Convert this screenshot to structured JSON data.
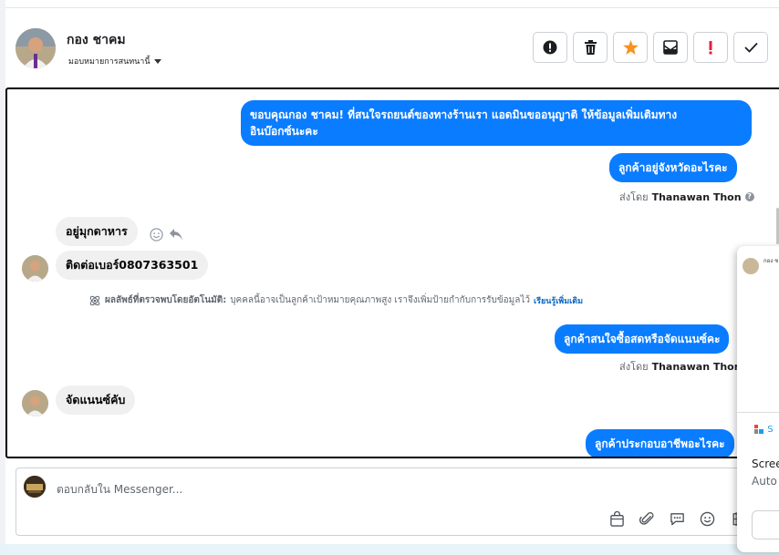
{
  "header": {
    "contact_name": "กอง ชาคม",
    "assign_label": "มอบหมายการสนทนานี้"
  },
  "toolbar": {
    "buttons": [
      {
        "icon": "exclamation-circle-icon"
      },
      {
        "icon": "trash-icon"
      },
      {
        "icon": "star-icon",
        "color": "#f7931e"
      },
      {
        "icon": "archive-mail-icon"
      },
      {
        "icon": "spam-icon",
        "color": "#e41e3f"
      },
      {
        "icon": "check-icon"
      }
    ]
  },
  "messages": {
    "out1_line1": "ขอบคุณกอง ชาคม! ที่สนใจรถยนต์ของทางร้านเรา แอดมินขออนุญาติ ให้ข้อมูลเพิ่มเติมทาง",
    "out1_line2": "อินบ๊อกซ์นะคะ",
    "out2": "ลูกค้าอยู่จังหวัดอะไรคะ",
    "sent_by_label_1": "ส่งโดย",
    "sent_by_name_1": "Thanawan Thon",
    "in1": "อยู่มุกดาหาร",
    "in2": "ติดต่อเบอร์0807363501",
    "auto_bold": "ผลลัพธ์ที่ตรวจพบโดยอัตโนมัติ:",
    "auto_text": "บุคคลนี้อาจเป็นลูกค้าเป้าหมายคุณภาพสูง เราจึงเพิ่มป้ายกำกับการรับข้อมูลไว้",
    "auto_link": "เรียนรู้เพิ่มเติม",
    "out3": "ลูกค้าสนใจซื้อสดหรือจัดแนนซ์คะ",
    "sent_by_label_2": "ส่งโดย",
    "sent_by_name_2": "Thanawan Thon",
    "in3": "จัดแนนซ์คับ",
    "out4": "ลูกค้าประกอบอาชีพอะไรคะ"
  },
  "composer": {
    "placeholder": "ตอบกลับใน Messenger..."
  },
  "overlay": {
    "name": "กอง ช",
    "logo_text": "S",
    "line1": "Scree",
    "line2": "Auto"
  },
  "colors": {
    "accent": "#0a7cff",
    "incoming_bubble": "#f0f0f0"
  }
}
